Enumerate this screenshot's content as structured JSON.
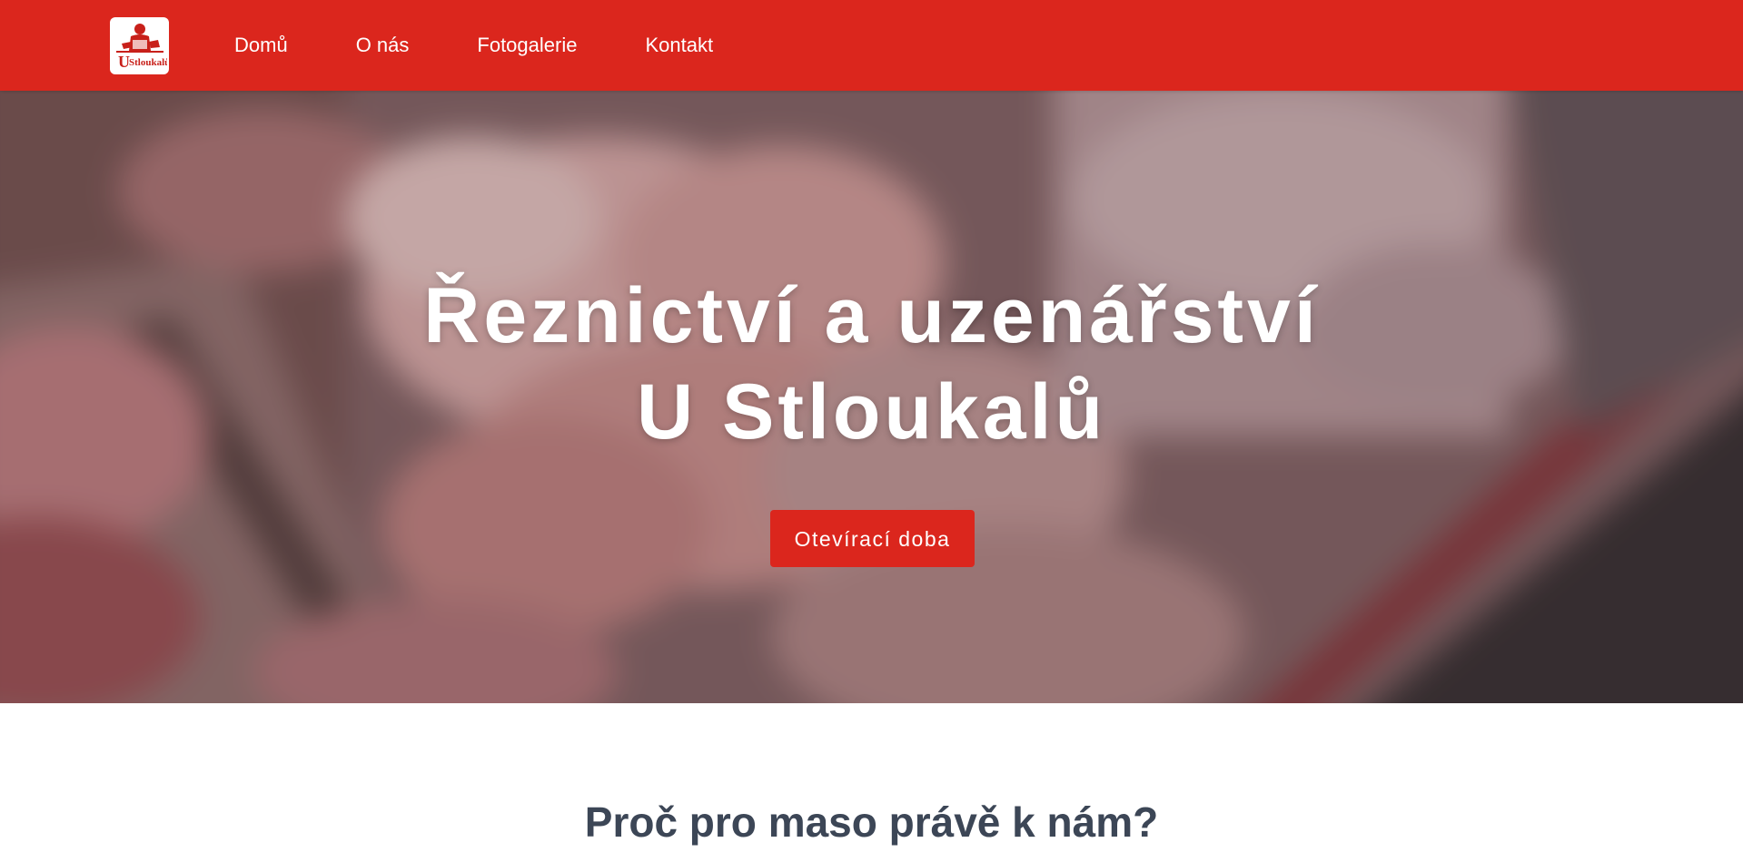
{
  "header": {
    "logo": {
      "alt_text": "U Stloukalů",
      "brand_line": "Řeznictví a uzenářství",
      "brand_name": "Stloukalů",
      "brand_letter": "U"
    },
    "nav": [
      {
        "label": "Domů"
      },
      {
        "label": "O nás"
      },
      {
        "label": "Fotogalerie"
      },
      {
        "label": "Kontakt"
      }
    ],
    "colors": {
      "accent": "#db261d"
    }
  },
  "hero": {
    "title_line1": "Řeznictví a uzenářství",
    "title_line2": "U Stloukalů",
    "button_label": "Otevírací doba",
    "background_description_icon": "blurred-meat-counter-image"
  },
  "section": {
    "heading": "Proč pro maso právě k nám?",
    "color": "#3c4656"
  }
}
